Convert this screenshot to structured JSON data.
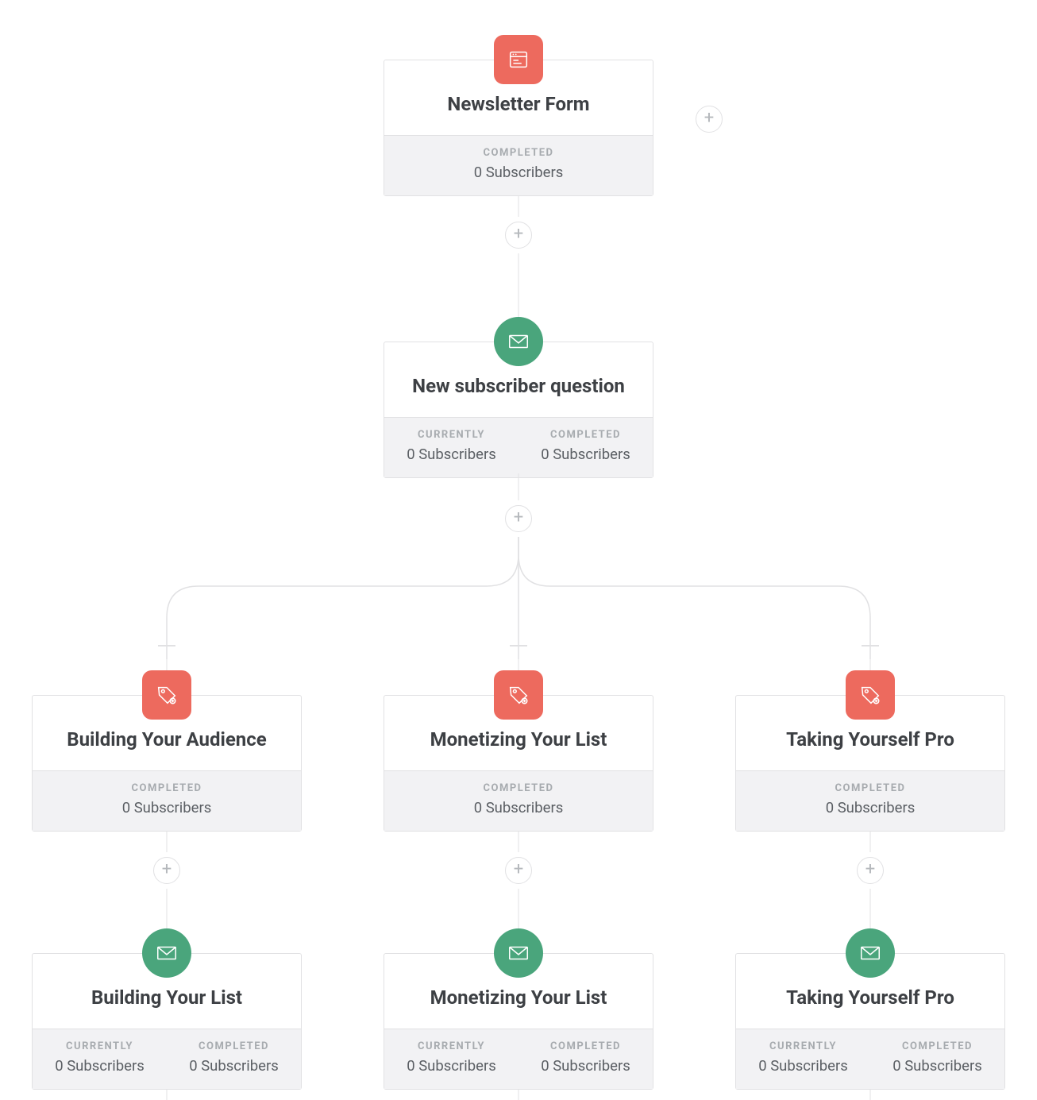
{
  "labels": {
    "currently": "CURRENTLY",
    "completed": "COMPLETED"
  },
  "root": {
    "title": "Newsletter Form",
    "completed": "0 Subscribers"
  },
  "question": {
    "title": "New subscriber question",
    "currently": "0 Subscribers",
    "completed": "0 Subscribers"
  },
  "branches": [
    {
      "tag": {
        "title": "Building Your Audience",
        "completed": "0 Subscribers"
      },
      "email": {
        "title": "Building Your List",
        "currently": "0 Subscribers",
        "completed": "0 Subscribers"
      }
    },
    {
      "tag": {
        "title": "Monetizing Your List",
        "completed": "0 Subscribers"
      },
      "email": {
        "title": "Monetizing Your List",
        "currently": "0 Subscribers",
        "completed": "0 Subscribers"
      }
    },
    {
      "tag": {
        "title": "Taking Yourself Pro",
        "completed": "0 Subscribers"
      },
      "email": {
        "title": "Taking Yourself Pro",
        "currently": "0 Subscribers",
        "completed": "0 Subscribers"
      }
    }
  ]
}
